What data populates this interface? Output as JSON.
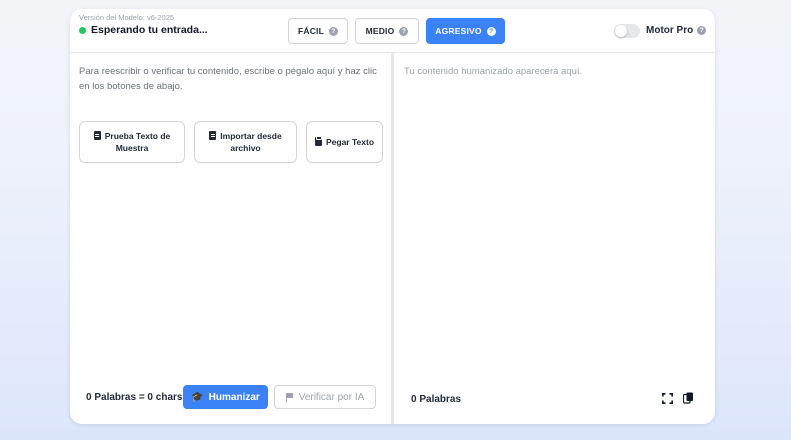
{
  "header": {
    "version_label": "Versión del Modelo: v6-2025",
    "status_text": "Esperando tu entrada...",
    "status_color": "#22c55e",
    "modes": [
      {
        "label": "FÁCIL",
        "active": false
      },
      {
        "label": "MEDIO",
        "active": false
      },
      {
        "label": "AGRESIVO",
        "active": true
      }
    ],
    "help_glyph": "?",
    "toggle_label": "Motor Pro",
    "toggle_on": false
  },
  "input": {
    "placeholder": "Para reescribir o verificar tu contenido, escribe o pégalo aquí y haz clic en los botones de abajo.",
    "buttons": [
      {
        "label": "Prueba Texto de Muestra",
        "icon": "document-icon"
      },
      {
        "label": "Importar desde archivo",
        "icon": "file-import-icon"
      },
      {
        "label": "Pegar Texto",
        "icon": "clipboard-icon"
      }
    ],
    "word_count": "0 Palabras = 0 chars",
    "humanize_label": "Humanizar",
    "verify_label": "Verificar por IA"
  },
  "output": {
    "placeholder": "Tu contenido humanizado aparecerá aquí.",
    "word_count": "0 Palabras"
  },
  "colors": {
    "accent": "#3b82f6",
    "status_green": "#22c55e"
  }
}
